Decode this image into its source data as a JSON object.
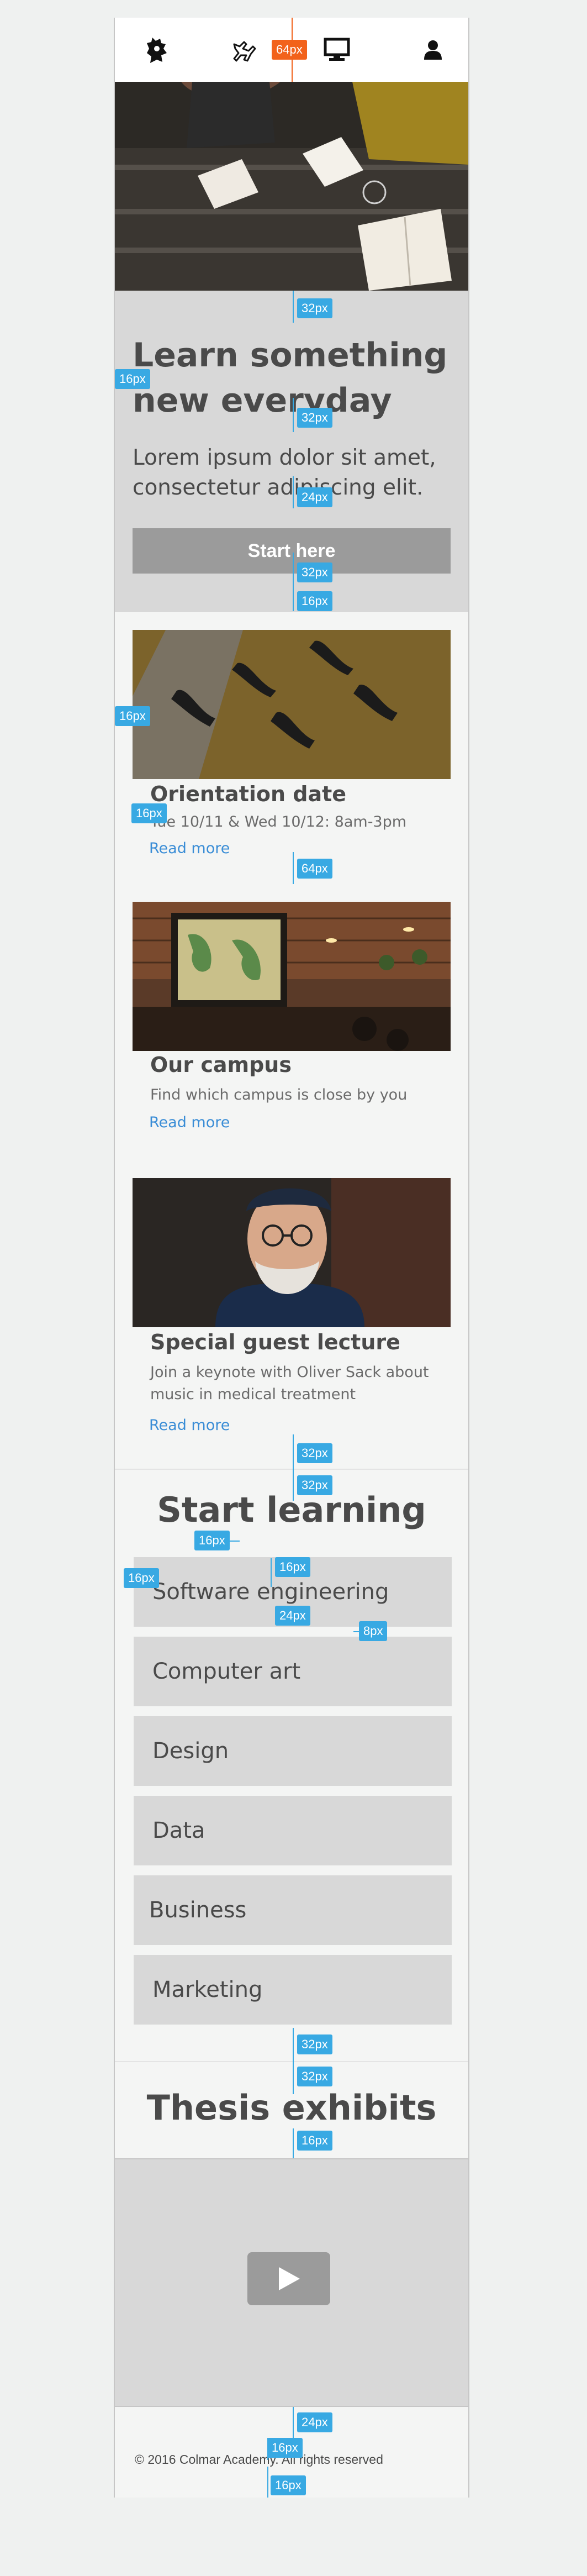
{
  "header": {
    "icons": [
      "academy-crest-icon",
      "flying-woman-icon",
      "desktop-monitor-icon",
      "user-icon"
    ]
  },
  "hero": {
    "title": "Learn something new everyday",
    "subtitle": "Lorem ipsum dolor sit amet, consectetur adipiscing elit.",
    "button_label": "Start here"
  },
  "cards": [
    {
      "title": "Orientation date",
      "text": "Tue 10/11 & Wed 10/12: 8am-3pm",
      "link": "Read more"
    },
    {
      "title": "Our campus",
      "text": "Find which campus is close by you",
      "link": "Read more"
    },
    {
      "title": "Special guest lecture",
      "text": "Join a keynote with Oliver Sack about music in medical treatment",
      "link": "Read more"
    }
  ],
  "learning": {
    "title": "Start learning",
    "courses": [
      "Software engineering",
      "Computer art",
      "Design",
      "Data",
      "Business",
      "Marketing"
    ]
  },
  "exhibits": {
    "title": "Thesis exhibits",
    "video_icon": "play-icon"
  },
  "footer": {
    "copyright": "© 2016 Colmar Academy. All rights reserved"
  },
  "annotations": [
    "64px",
    "32px",
    "16px",
    "32px",
    "24px",
    "32px",
    "16px",
    "16px",
    "16px",
    "64px",
    "32px",
    "32px",
    "16px",
    "16px",
    "16px",
    "24px",
    "8px",
    "32px",
    "32px",
    "16px",
    "24px",
    "16px",
    "16px"
  ],
  "colors": {
    "annotation_blue": "#38a9e3",
    "annotation_orange": "#f2621b",
    "link": "#3a8dd6",
    "panel_gray": "#d8d8d8",
    "button_gray": "#9b9b9b"
  }
}
